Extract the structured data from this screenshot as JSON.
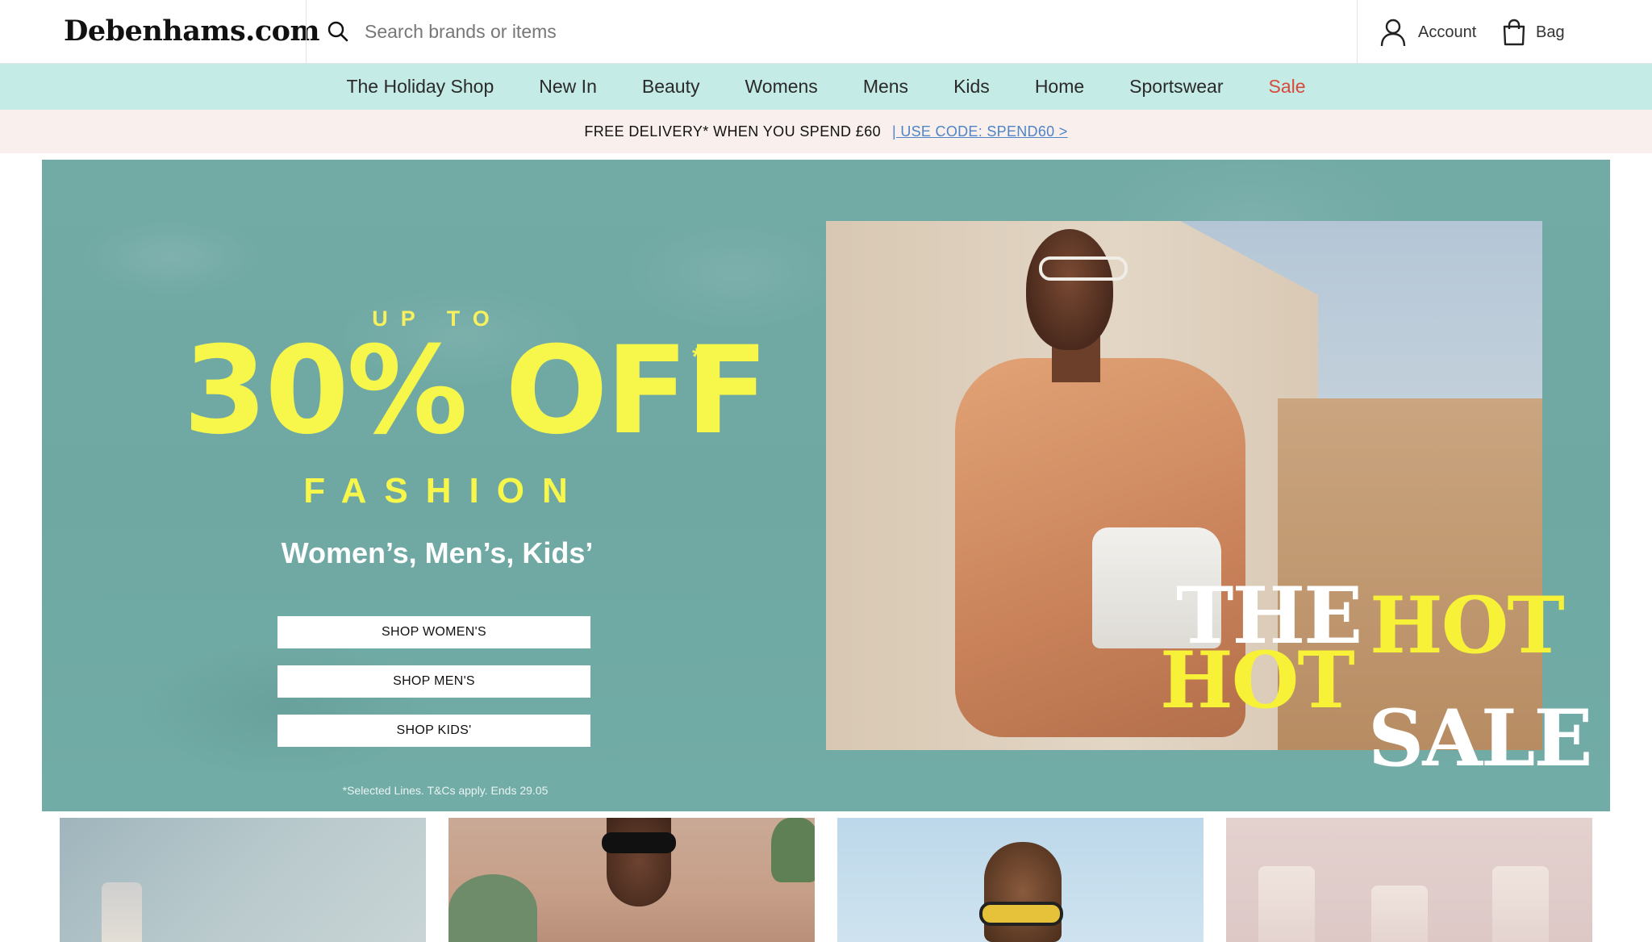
{
  "header": {
    "logo": "Debenhams.com",
    "search_placeholder": "Search brands or items",
    "account_label": "Account",
    "bag_label": "Bag"
  },
  "nav": {
    "items": [
      {
        "label": "The Holiday Shop"
      },
      {
        "label": "New In"
      },
      {
        "label": "Beauty"
      },
      {
        "label": "Womens"
      },
      {
        "label": "Mens"
      },
      {
        "label": "Kids"
      },
      {
        "label": "Home"
      },
      {
        "label": "Sportswear"
      },
      {
        "label": "Sale"
      }
    ],
    "sale_color": "#d8493c",
    "background": "#c4ebe6"
  },
  "promo": {
    "text": "FREE DELIVERY* WHEN YOU SPEND £60",
    "link": "| USE CODE: SPEND60 >"
  },
  "hero": {
    "up_to": "UP TO",
    "headline": "30% OFF",
    "asterisk": "*",
    "category": "FASHION",
    "subline": "Women’s, Men’s, Kids’",
    "buttons": [
      {
        "label": "SHOP WOMEN'S"
      },
      {
        "label": "SHOP MEN'S"
      },
      {
        "label": "SHOP KIDS'"
      }
    ],
    "note": "*Selected Lines. T&Cs apply. Ends 29.05",
    "logo_the": "THE",
    "logo_hot1": "HOT",
    "logo_hot2": "HOT",
    "logo_sale": "SALE",
    "accent_color": "#f6f64b",
    "background": "#6fa8a3"
  }
}
